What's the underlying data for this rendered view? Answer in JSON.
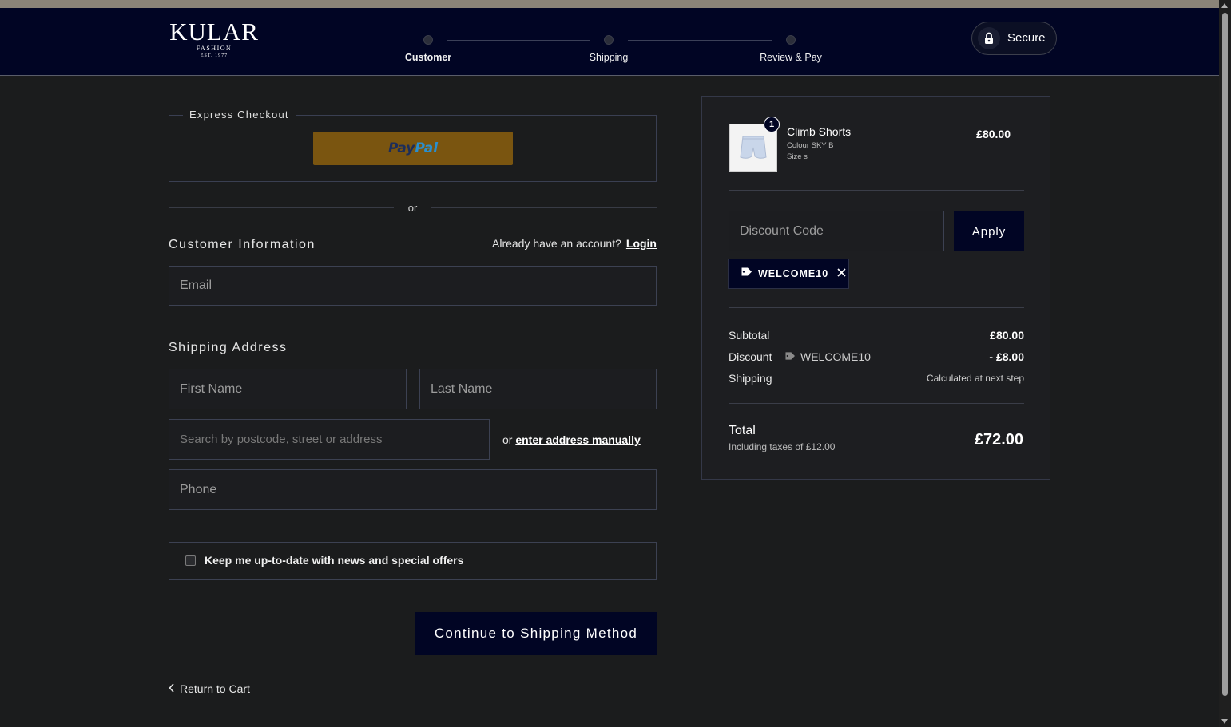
{
  "header": {
    "logo": {
      "main": "KULAR",
      "sub": "FASHION",
      "est": "EST. 1977"
    },
    "steps": [
      {
        "label": "Customer",
        "active": true
      },
      {
        "label": "Shipping",
        "active": false
      },
      {
        "label": "Review & Pay",
        "active": false
      }
    ],
    "secure_label": "Secure"
  },
  "express": {
    "legend": "Express Checkout",
    "paypal_part1": "Pay",
    "paypal_part2": "Pal",
    "or": "or"
  },
  "customer": {
    "title": "Customer Information",
    "account_prompt": "Already have an account?",
    "login_label": "Login",
    "email_placeholder": "Email"
  },
  "shipping": {
    "title": "Shipping Address",
    "first_name_placeholder": "First Name",
    "last_name_placeholder": "Last Name",
    "search_placeholder": "Search by postcode, street or address",
    "manual_prefix": "or",
    "manual_link": "enter address manually",
    "phone_placeholder": "Phone"
  },
  "newsletter_label": "Keep me up-to-date with news and special offers",
  "continue_label": "Continue to Shipping Method",
  "return_label": "Return to Cart",
  "summary": {
    "item": {
      "quantity": "1",
      "name": "Climb Shorts",
      "colour": "Colour SKY B",
      "size": "Size s",
      "price": "£80.00"
    },
    "discount_placeholder": "Discount Code",
    "apply_label": "Apply",
    "applied_code": "WELCOME10",
    "subtotal_label": "Subtotal",
    "subtotal_value": "£80.00",
    "discount_label": "Discount",
    "discount_code": "WELCOME10",
    "discount_value": "- £8.00",
    "shipping_label": "Shipping",
    "shipping_value": "Calculated at next step",
    "total_label": "Total",
    "taxes_note": "Including taxes of £12.00",
    "total_value": "£72.00"
  },
  "colors": {
    "header_bg": "#010524",
    "page_bg": "#1b1c1d",
    "paypal_button": "#7a5510",
    "primary_button": "#010524"
  }
}
